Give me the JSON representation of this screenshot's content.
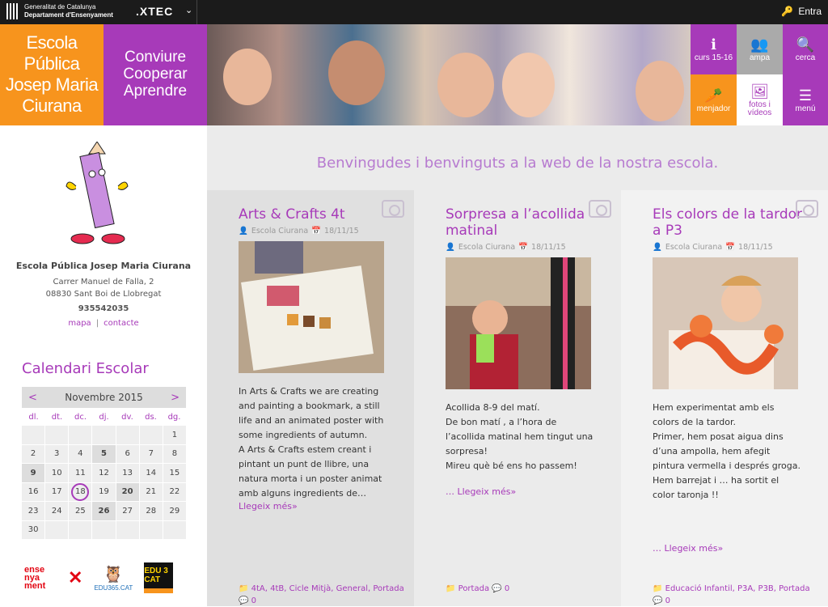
{
  "topbar": {
    "gencat_line1": "Generalitat de Catalunya",
    "gencat_line2": "Departament d'Ensenyament",
    "xtec": ".XTEC",
    "xtec_arrow": "⌄",
    "login_label": "Entra"
  },
  "header": {
    "school_name": [
      "Escola",
      "Pública",
      "Josep Maria",
      "Ciurana"
    ],
    "motto": [
      "Conviure",
      "Cooperar",
      "Aprendre"
    ],
    "tiles": [
      {
        "label": "curs 15-16",
        "icon": "info-icon",
        "glyph": "ℹ"
      },
      {
        "label": "ampa",
        "icon": "group-icon",
        "glyph": "👥"
      },
      {
        "label": "cerca",
        "icon": "search-icon",
        "glyph": "🔍"
      },
      {
        "label": "menjador",
        "icon": "carrot-icon",
        "glyph": "🥕"
      },
      {
        "label": "fotos i vídeos",
        "icon": "photos-icon",
        "glyph": "🖼"
      },
      {
        "label": "menú",
        "icon": "menu-icon",
        "glyph": "☰"
      }
    ]
  },
  "sidebar": {
    "name": "Escola Pública Josep Maria Ciurana",
    "address1": "Carrer Manuel de Falla, 2",
    "address2": "08830 Sant Boi de Llobregat",
    "phone": "935542035",
    "link_map": "mapa",
    "link_contact": "contacte",
    "calendar_title": "Calendari Escolar",
    "calendar": {
      "prev": "<",
      "next": ">",
      "month": "Novembre  2015",
      "dow": [
        "dl.",
        "dt.",
        "dc.",
        "dj.",
        "dv.",
        "ds.",
        "dg."
      ],
      "weeks": [
        [
          "",
          "",
          "",
          "",
          "",
          "",
          "1"
        ],
        [
          "2",
          "3",
          "4",
          "5",
          "6",
          "7",
          "8"
        ],
        [
          "9",
          "10",
          "11",
          "12",
          "13",
          "14",
          "15"
        ],
        [
          "16",
          "17",
          "18",
          "19",
          "20",
          "21",
          "22"
        ],
        [
          "23",
          "24",
          "25",
          "26",
          "27",
          "28",
          "29"
        ],
        [
          "30",
          "",
          "",
          "",
          "",
          "",
          ""
        ]
      ],
      "bold_days": [
        "5",
        "9",
        "20",
        "26"
      ],
      "today": "18"
    },
    "logos": {
      "ens": "ense nya ment",
      "edu365": "EDU365.CAT",
      "edu3": "EDU 3 CAT"
    }
  },
  "main": {
    "welcome": "Benvingudes i benvinguts a la web de la nostra escola.",
    "posts": [
      {
        "title": "Arts & Crafts 4t",
        "author": "Escola Ciurana",
        "date": "18/11/15",
        "text": "In Arts & Crafts we are creating and painting a bookmark, a still life and an animated poster with some ingredients of autumn.\nA Arts & Crafts estem creant i pintant un punt de llibre, una natura morta i un poster animat amb alguns ingredients de…",
        "more": "Llegeix més»",
        "tags": "4tA,  4tB,  Cicle Mitjà,  General,  Portada",
        "comments": "0"
      },
      {
        "title": "Sorpresa a l’acollida matinal",
        "author": "Escola Ciurana",
        "date": "18/11/15",
        "text": "Acollida 8-9 del matí.\nDe bon matí , a l’hora de l’acollida matinal hem tingut una sorpresa!\nMireu què bé ens ho passem!",
        "more": "… Llegeix més»",
        "tags": "Portada",
        "comments": "0"
      },
      {
        "title": "Els colors de la tardor a P3",
        "author": "Escola Ciurana",
        "date": "18/11/15",
        "text": "Hem experimentat amb els colors de la tardor.\nPrimer, hem posat aigua dins d’una ampolla, hem afegit pintura vermella i després groga.  Hem barrejat i … ha sortit el color taronja !!",
        "more": "… Llegeix més»",
        "tags": "Educació Infantil,  P3A,  P3B,  Portada",
        "comments": "0"
      }
    ]
  }
}
